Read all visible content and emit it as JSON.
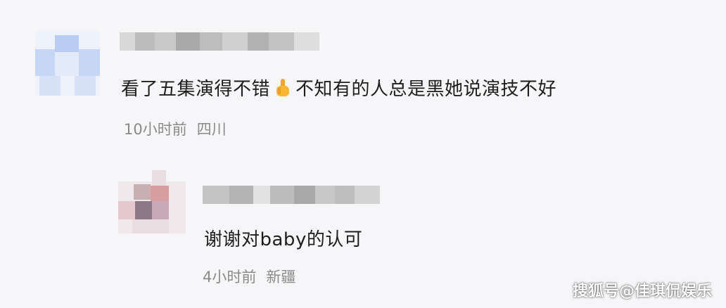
{
  "comments": [
    {
      "text_before_emoji": "看了五集演得不错",
      "emoji_icon": "thumbs-up-icon",
      "text_after_emoji": "不知有的人总是黑她说演技不好",
      "time": "10小时前",
      "location": "四川"
    },
    {
      "text": "谢谢对baby的认可",
      "time": "4小时前",
      "location": "新疆"
    }
  ],
  "watermark": "搜狐号@佳琪侃娱乐",
  "colors": {
    "emoji": "#f5a623",
    "meta": "#8a8a8a"
  }
}
